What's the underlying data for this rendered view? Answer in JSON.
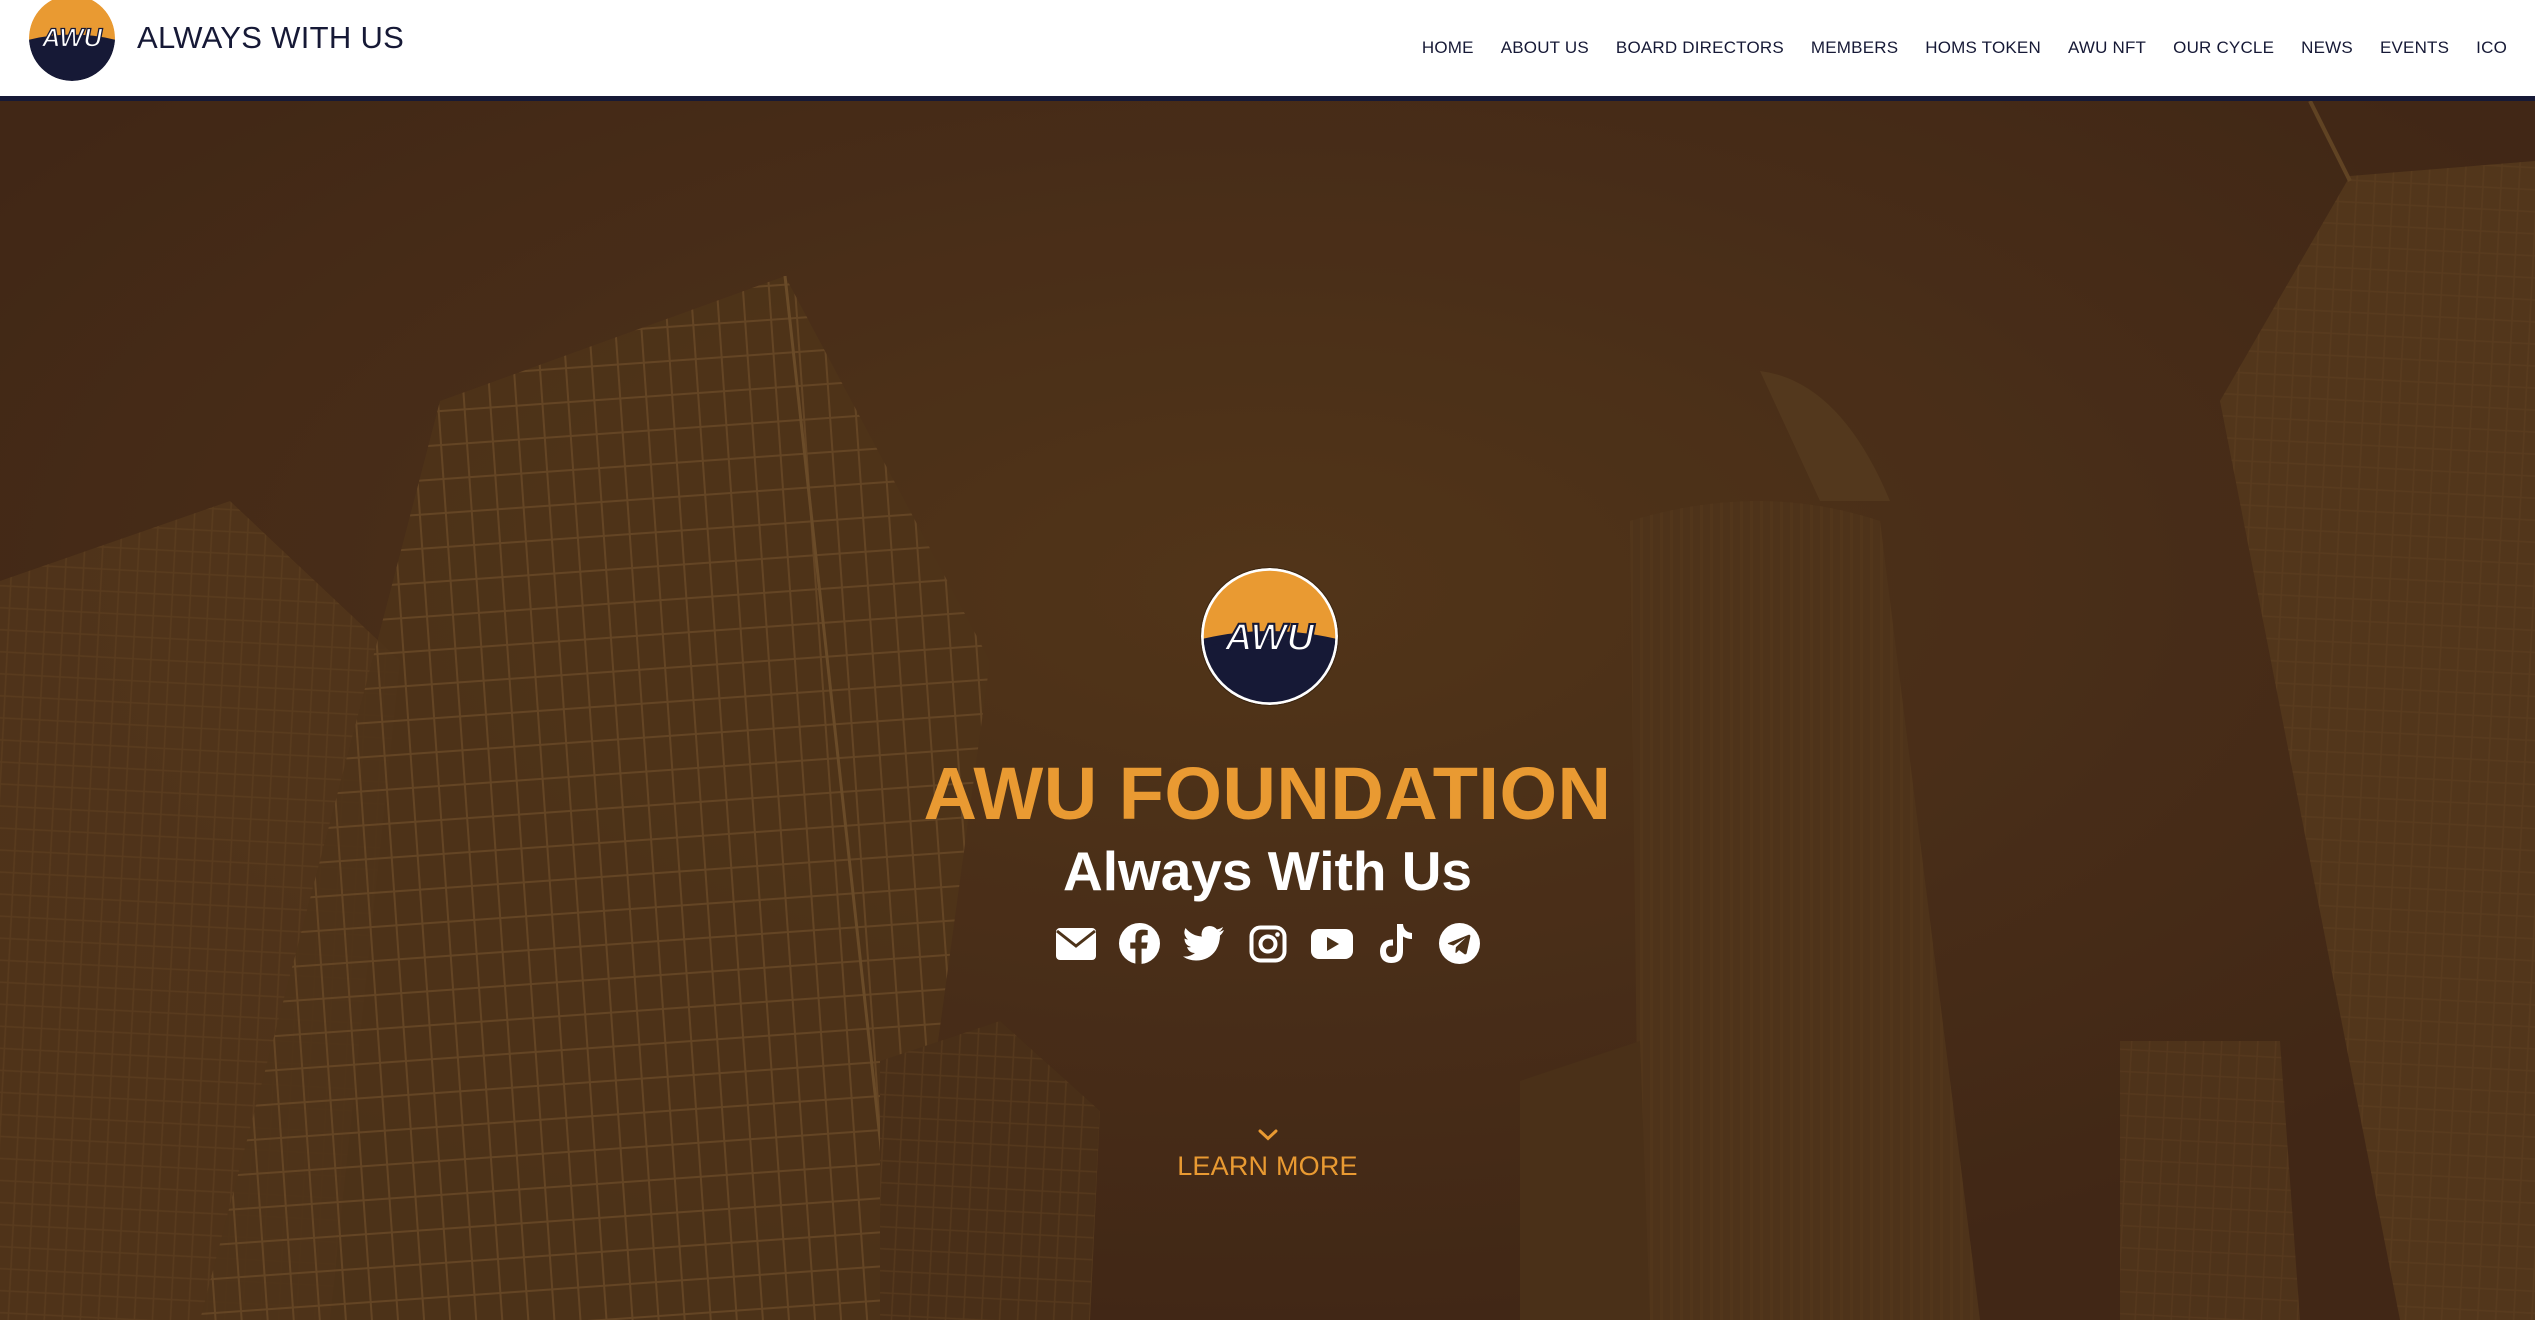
{
  "header": {
    "logo_text": "AWU",
    "site_title": "ALWAYS WITH US"
  },
  "nav": {
    "items": [
      "HOME",
      "ABOUT US",
      "BOARD DIRECTORS",
      "MEMBERS",
      "HOMS TOKEN",
      "AWU NFT",
      "OUR CYCLE",
      "NEWS",
      "EVENTS",
      "ICO"
    ]
  },
  "hero": {
    "logo_text": "AWU",
    "title": "AWU FOUNDATION",
    "subtitle": "Always With Us",
    "socials": [
      "envelope-icon",
      "facebook-icon",
      "twitter-icon",
      "instagram-icon",
      "youtube-icon",
      "tiktok-icon",
      "telegram-icon"
    ],
    "learn_more": "LEARN MORE"
  },
  "colors": {
    "accent_orange": "#e99a32",
    "navy": "#161936",
    "overlay_brown": "#4c3219",
    "white": "#ffffff"
  }
}
